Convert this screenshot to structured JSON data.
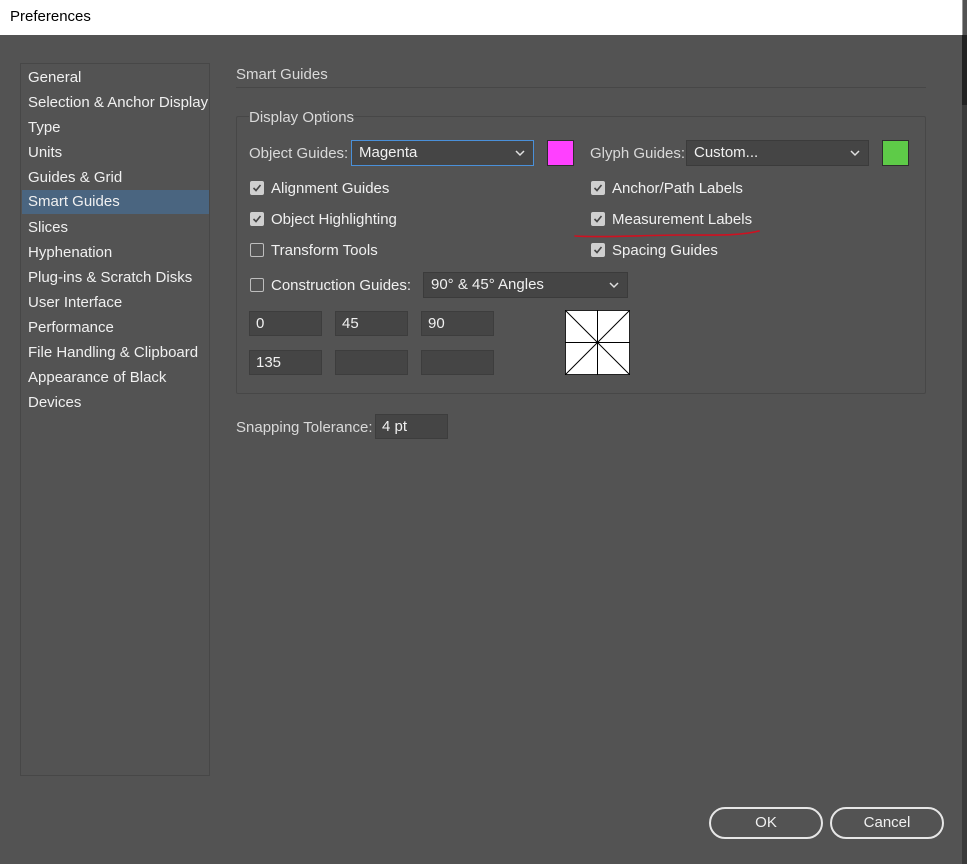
{
  "window": {
    "title": "Preferences"
  },
  "sidebar": {
    "selected_index": 5,
    "items": [
      {
        "label": "General"
      },
      {
        "label": "Selection & Anchor Display"
      },
      {
        "label": "Type"
      },
      {
        "label": "Units"
      },
      {
        "label": "Guides & Grid"
      },
      {
        "label": "Smart Guides"
      },
      {
        "label": "Slices"
      },
      {
        "label": "Hyphenation"
      },
      {
        "label": "Plug-ins & Scratch Disks"
      },
      {
        "label": "User Interface"
      },
      {
        "label": "Performance"
      },
      {
        "label": "File Handling & Clipboard"
      },
      {
        "label": "Appearance of Black"
      },
      {
        "label": "Devices"
      }
    ]
  },
  "main": {
    "section_title": "Smart Guides",
    "display_options": {
      "group_title": "Display Options",
      "object_guides": {
        "label": "Object Guides:",
        "value": "Magenta",
        "color": "#ff40ff"
      },
      "glyph_guides": {
        "label": "Glyph Guides:",
        "value": "Custom...",
        "color": "#5ecb48"
      },
      "checkboxes": {
        "alignment_guides": {
          "label": "Alignment Guides",
          "checked": true
        },
        "object_highlighting": {
          "label": "Object Highlighting",
          "checked": true
        },
        "transform_tools": {
          "label": "Transform Tools",
          "checked": false
        },
        "anchor_path_labels": {
          "label": "Anchor/Path Labels",
          "checked": true
        },
        "measurement_labels": {
          "label": "Measurement Labels",
          "checked": true
        },
        "spacing_guides": {
          "label": "Spacing Guides",
          "checked": true
        },
        "construction_guides": {
          "label": "Construction Guides:",
          "checked": false
        }
      },
      "construction_angles": {
        "value": "90° & 45° Angles"
      },
      "angle_fields": [
        "0",
        "45",
        "90",
        "135",
        "",
        ""
      ]
    },
    "snapping_tolerance": {
      "label": "Snapping Tolerance:",
      "value": "4 pt"
    }
  },
  "buttons": {
    "ok": "OK",
    "cancel": "Cancel"
  },
  "annotation": {
    "color": "#d01020"
  }
}
